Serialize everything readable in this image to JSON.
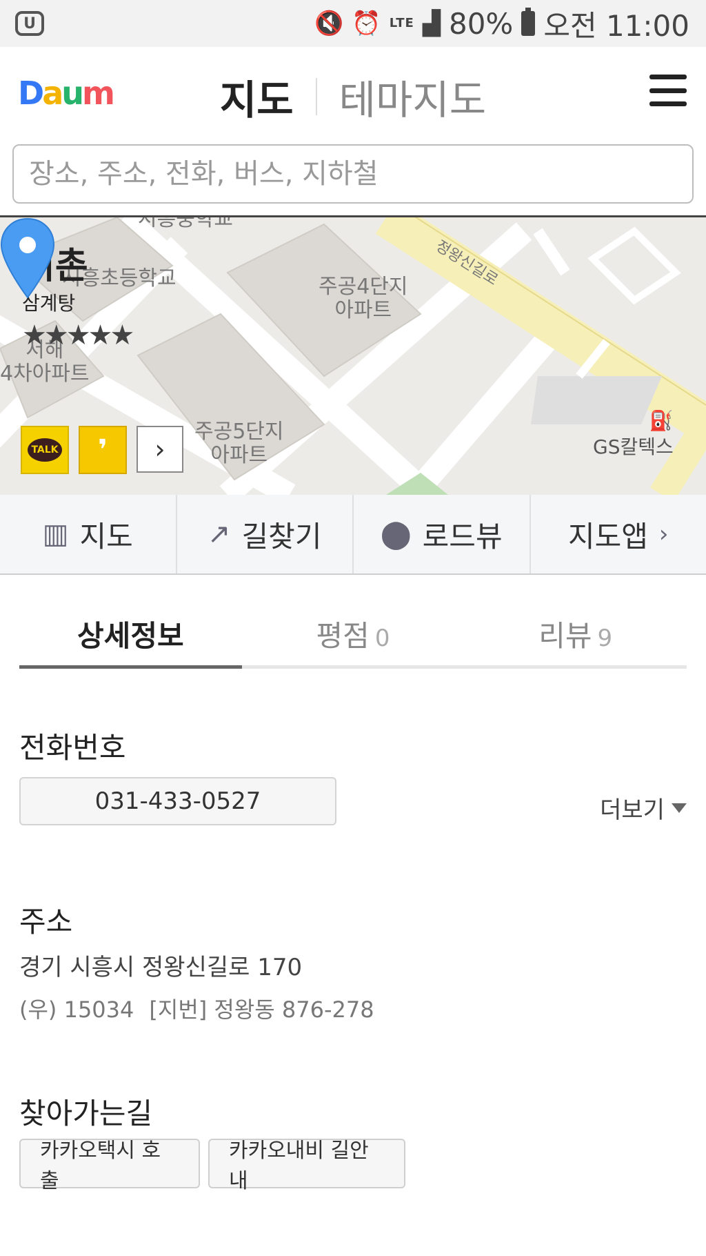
{
  "status_bar": {
    "battery": "80%",
    "time": "오전 11:00",
    "network": "LTE"
  },
  "header": {
    "logo": "Daum",
    "tab_map": "지도",
    "tab_theme": "테마지도"
  },
  "search": {
    "placeholder": "장소, 주소, 전화, 버스, 지하철",
    "value": ""
  },
  "map": {
    "labels": [
      "시흥초등학교",
      "주공4단지",
      "아파트",
      "주공5단지",
      "아파트",
      "GS칼텍스",
      "정왕신길로",
      "서해",
      "4차아파트"
    ]
  },
  "place": {
    "name": "거촌",
    "category": "삼계탕",
    "rating_stars": "★★★★★"
  },
  "actions": [
    {
      "label": "지도",
      "icon": "map-icon"
    },
    {
      "label": "길찾기",
      "icon": "route-icon"
    },
    {
      "label": "로드뷰",
      "icon": "roadview-icon"
    },
    {
      "label": "지도앱",
      "icon": "chevron-right-icon"
    }
  ],
  "detail_tabs": [
    {
      "label": "상세정보",
      "count": ""
    },
    {
      "label": "평점",
      "count": "0"
    },
    {
      "label": "리뷰",
      "count": "9"
    }
  ],
  "phone": {
    "title": "전화번호",
    "number": "031-433-0527",
    "more_label": "더보기"
  },
  "address": {
    "title": "주소",
    "road": "경기 시흥시 정왕신길로 170",
    "postal": "(우) 15034",
    "lot": "[지번] 정왕동 876-278"
  },
  "directions": {
    "title": "찾아가는길",
    "buttons": [
      "카카오택시 호출",
      "카카오내비 길안내"
    ]
  }
}
